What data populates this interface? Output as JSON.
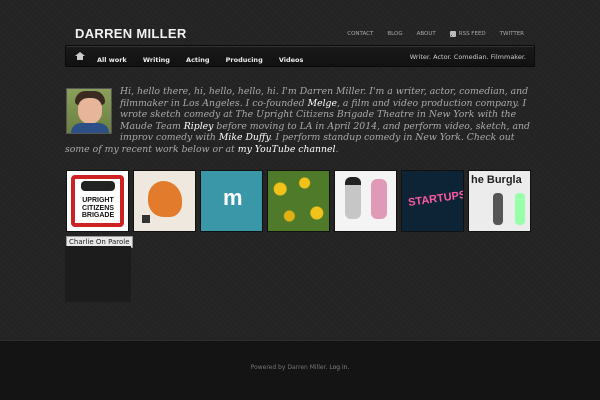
{
  "site": {
    "title": "DARREN MILLER",
    "tagline": "Writer. Actor. Comedian. Filmmaker."
  },
  "topnav": {
    "contact": "CONTACT",
    "blog": "BLOG",
    "about": "ABOUT",
    "rss": "RSS FEED",
    "twitter": "TWITTER"
  },
  "mainnav": {
    "home_icon": "home-icon",
    "items": [
      "All work",
      "Writing",
      "Acting",
      "Producing",
      "Videos"
    ]
  },
  "bio": {
    "p1": "Hi, hello there, hi, hello, hello, hi. I'm Darren Miller. I'm a writer, actor, comedian, and filmmaker in Los Angeles. I co-founded ",
    "link_melge": "Melge",
    "p2": ", a film and video production company. I wrote sketch comedy at The Upright Citizens Brigade Theatre in New York with the Maude Team ",
    "link_ripley": "Ripley",
    "p3": " before moving to LA in April 2014, and perform video, sketch, and improv comedy with ",
    "link_duffy": "Mike Duffy",
    "p4": ". I perform standup comedy in New York. Check out some of my recent work below or at ",
    "link_youtube": "my YouTube channel",
    "p5": "."
  },
  "thumbnails": {
    "t1_text": "UPRIGHT CITIZENS BRIGADE",
    "t3_text": "m",
    "t6_text": "STARTUPS",
    "t7_text": "he Burgla",
    "caption": "Charlie On Parole"
  },
  "footer": {
    "powered": "Powered by Darren Miller.",
    "login": "Log in."
  }
}
